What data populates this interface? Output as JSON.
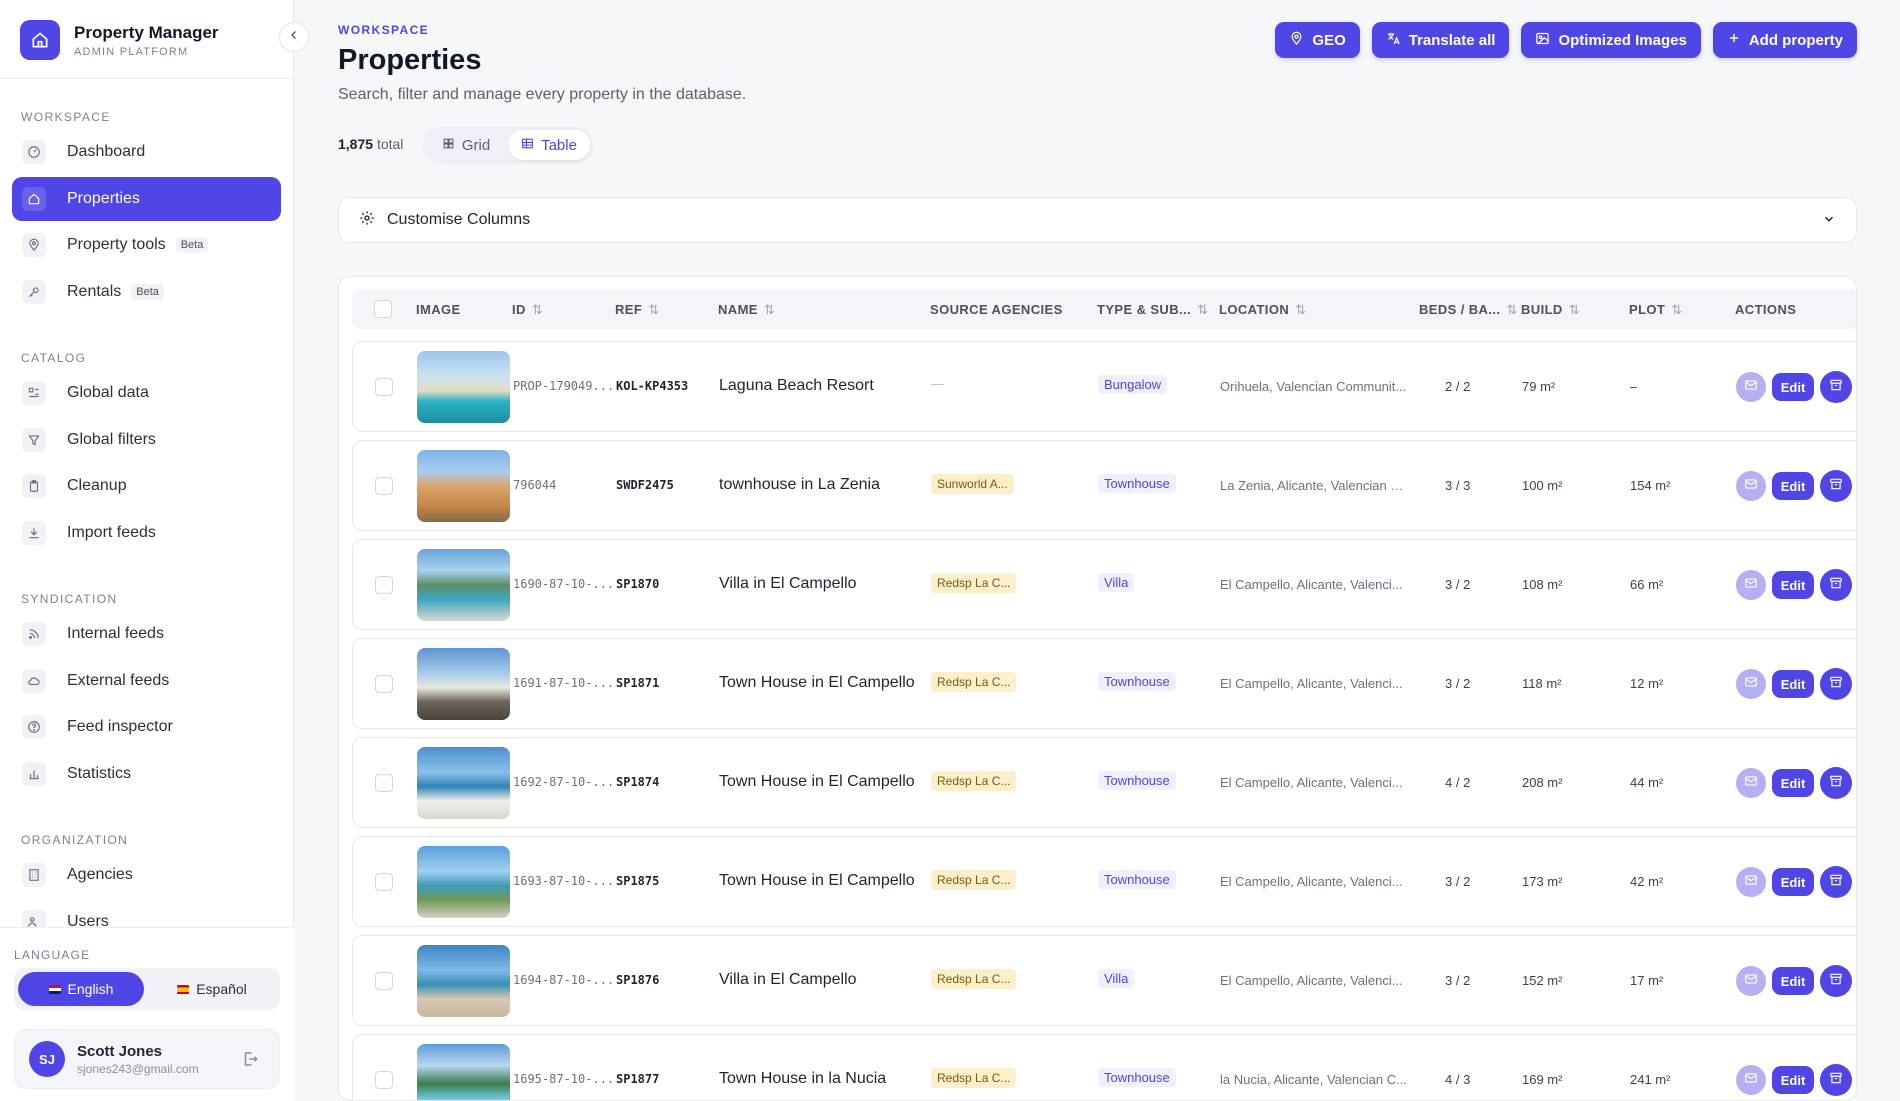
{
  "brand": {
    "title": "Property Manager",
    "subtitle": "ADMIN PLATFORM"
  },
  "sidebar": {
    "sections": [
      {
        "label": "WORKSPACE",
        "items": [
          {
            "label": "Dashboard",
            "icon": "dashboard-icon"
          },
          {
            "label": "Properties",
            "icon": "home-icon",
            "active": true
          },
          {
            "label": "Property tools",
            "icon": "location-pin-icon",
            "badge": "Beta"
          },
          {
            "label": "Rentals",
            "icon": "key-icon",
            "badge": "Beta"
          }
        ]
      },
      {
        "label": "CATALOG",
        "items": [
          {
            "label": "Global data",
            "icon": "list-icon"
          },
          {
            "label": "Global filters",
            "icon": "filter-icon"
          },
          {
            "label": "Cleanup",
            "icon": "clipboard-icon"
          },
          {
            "label": "Import feeds",
            "icon": "download-icon"
          }
        ]
      },
      {
        "label": "SYNDICATION",
        "items": [
          {
            "label": "Internal feeds",
            "icon": "rss-icon"
          },
          {
            "label": "External feeds",
            "icon": "cloud-icon"
          },
          {
            "label": "Feed inspector",
            "icon": "help-circle-icon"
          },
          {
            "label": "Statistics",
            "icon": "bar-chart-icon"
          }
        ]
      },
      {
        "label": "ORGANIZATION",
        "items": [
          {
            "label": "Agencies",
            "icon": "building-icon"
          },
          {
            "label": "Users",
            "icon": "users-icon"
          }
        ]
      }
    ]
  },
  "language": {
    "label": "LANGUAGE",
    "options": [
      {
        "label": "English",
        "active": true
      },
      {
        "label": "Español",
        "active": false
      }
    ]
  },
  "user": {
    "initials": "SJ",
    "name": "Scott Jones",
    "email": "sjones243@gmail.com"
  },
  "header": {
    "eyebrow": "WORKSPACE",
    "title": "Properties",
    "subtitle": "Search, filter and manage every property in the database.",
    "actions": [
      "GEO",
      "Translate all",
      "Optimized Images",
      "Add property"
    ]
  },
  "toolbar": {
    "total_count": "1,875",
    "total_suffix": "total",
    "views": [
      {
        "label": "Grid",
        "active": false
      },
      {
        "label": "Table",
        "active": true
      }
    ]
  },
  "customise": {
    "label": "Customise Columns"
  },
  "table": {
    "columns": [
      "IMAGE",
      "ID",
      "REF",
      "NAME",
      "SOURCE AGENCIES",
      "TYPE & SUB...",
      "LOCATION",
      "BEDS / BA...",
      "BUILD",
      "PLOT",
      "ACTIONS"
    ],
    "edit_label": "Edit",
    "rows": [
      {
        "id": "PROP-179049...",
        "ref": "KOL-KP4353",
        "name": "Laguna Beach Resort",
        "source": "",
        "type": "Bungalow",
        "location": "Orihuela, Valencian Communit...",
        "beds": "2 / 2",
        "build": "79 m²",
        "plot": "–"
      },
      {
        "id": "796044",
        "ref": "SWDF2475",
        "name": "townhouse in La Zenia",
        "source": "Sunworld A...",
        "type": "Townhouse",
        "location": "La Zenia, Alicante, Valencian C...",
        "beds": "3 / 3",
        "build": "100 m²",
        "plot": "154 m²"
      },
      {
        "id": "1690-87-10-...",
        "ref": "SP1870",
        "name": "Villa in El Campello",
        "source": "Redsp La C...",
        "type": "Villa",
        "location": "El Campello, Alicante, Valenci...",
        "beds": "3 / 2",
        "build": "108 m²",
        "plot": "66 m²"
      },
      {
        "id": "1691-87-10-...",
        "ref": "SP1871",
        "name": "Town House in El Campello",
        "source": "Redsp La C...",
        "type": "Townhouse",
        "location": "El Campello, Alicante, Valenci...",
        "beds": "3 / 2",
        "build": "118 m²",
        "plot": "12 m²"
      },
      {
        "id": "1692-87-10-...",
        "ref": "SP1874",
        "name": "Town House in El Campello",
        "source": "Redsp La C...",
        "type": "Townhouse",
        "location": "El Campello, Alicante, Valenci...",
        "beds": "4 / 2",
        "build": "208 m²",
        "plot": "44 m²"
      },
      {
        "id": "1693-87-10-...",
        "ref": "SP1875",
        "name": "Town House in El Campello",
        "source": "Redsp La C...",
        "type": "Townhouse",
        "location": "El Campello, Alicante, Valenci...",
        "beds": "3 / 2",
        "build": "173 m²",
        "plot": "42 m²"
      },
      {
        "id": "1694-87-10-...",
        "ref": "SP1876",
        "name": "Villa in El Campello",
        "source": "Redsp La C...",
        "type": "Villa",
        "location": "El Campello, Alicante, Valenci...",
        "beds": "3 / 2",
        "build": "152 m²",
        "plot": "17 m²"
      },
      {
        "id": "1695-87-10-...",
        "ref": "SP1877",
        "name": "Town House in la Nucia",
        "source": "Redsp La C...",
        "type": "Townhouse",
        "location": "la Nucia, Alicante, Valencian C...",
        "beds": "4 / 3",
        "build": "169 m²",
        "plot": "241 m²"
      }
    ]
  },
  "colors": {
    "accent": "#4f46e5",
    "source_badge_bg": "#fcefc9",
    "type_badge_bg": "#eef0ff"
  }
}
